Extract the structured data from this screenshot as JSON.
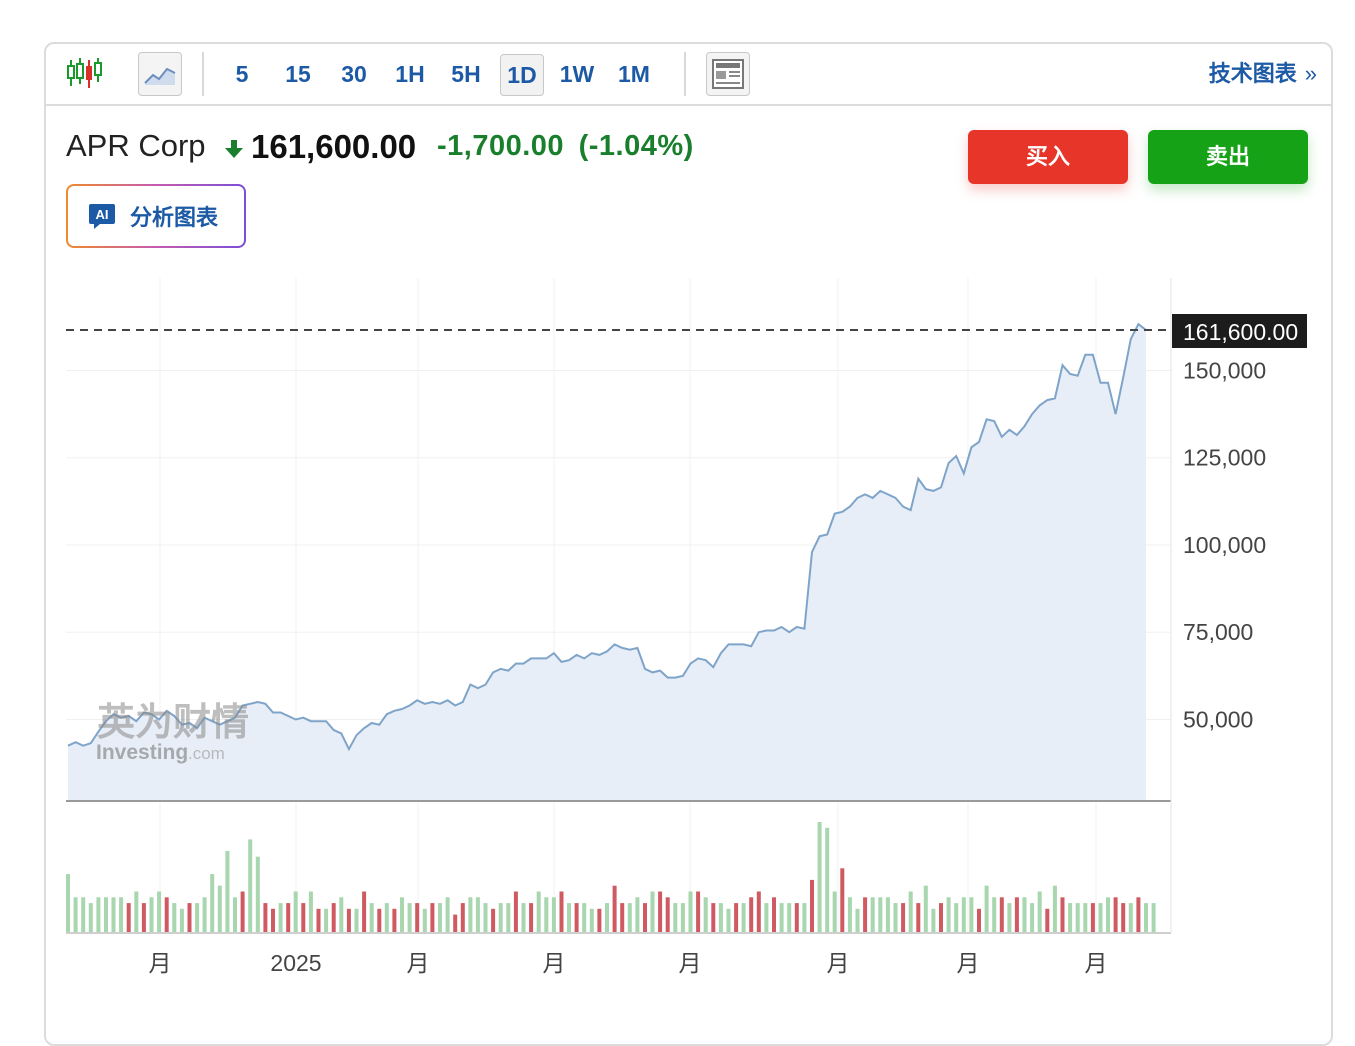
{
  "toolbar": {
    "timeframes": [
      "5",
      "15",
      "30",
      "1H",
      "5H",
      "1D",
      "1W",
      "1M"
    ],
    "active_timeframe": "1D",
    "tech_chart_label": "技术图表",
    "tech_chart_arrow": "»",
    "icons": [
      "candlestick-icon",
      "line-chart-icon",
      "layout-icon"
    ]
  },
  "quote": {
    "name": "APR Corp",
    "direction": "down",
    "price": "161,600.00",
    "change": "-1,700.00",
    "change_pct": "(-1.04%)",
    "change_color": "#1a7f2c"
  },
  "actions": {
    "buy_label": "买入",
    "sell_label": "卖出",
    "buy_color": "#e8352a",
    "sell_color": "#15a216"
  },
  "ai": {
    "badge": "AI",
    "label": "分析图表"
  },
  "watermark": {
    "cn": "英为财情",
    "en": "Investing",
    "suffix": ".com"
  },
  "chart_data": {
    "type": "area",
    "title": "",
    "xlabel": "",
    "ylabel": "",
    "x_tick_labels": [
      "月",
      "2025",
      "月",
      "月",
      "月",
      "月",
      "月",
      "月"
    ],
    "y_tick_labels": [
      "150,000",
      "125,000",
      "100,000",
      "75,000",
      "50,000"
    ],
    "y_ticks": [
      150000,
      125000,
      100000,
      75000,
      50000
    ],
    "ylim": [
      28000,
      166000
    ],
    "last_price_label": "161,600.00",
    "last_price": 161600,
    "grid": true,
    "series": [
      {
        "values": [
          42500,
          43500,
          42500,
          43200,
          46500,
          49500,
          51500,
          50500,
          51000,
          49500,
          52000,
          51500,
          50000,
          52500,
          51000,
          48500,
          49000,
          47500,
          50500,
          49500,
          48500,
          49500,
          50500,
          54000,
          54500,
          55000,
          54500,
          52000,
          52000,
          51000,
          50000,
          50500,
          49500,
          49500,
          49500,
          47000,
          46000,
          41500,
          45500,
          47500,
          49000,
          48500,
          51500,
          52500,
          53000,
          54000,
          55500,
          54500,
          55000,
          54500,
          55500,
          54000,
          55000,
          60000,
          59000,
          60000,
          63500,
          64500,
          64000,
          66000,
          66000,
          67500,
          67500,
          67500,
          69000,
          66500,
          67000,
          68500,
          67500,
          69000,
          68500,
          69500,
          71500,
          70500,
          70000,
          70500,
          64500,
          63500,
          64000,
          62000,
          62000,
          62500,
          66000,
          67500,
          67000,
          65000,
          69000,
          71500,
          71500,
          71500,
          71000,
          75000,
          75500,
          75500,
          76500,
          75000,
          76500,
          76000,
          98000,
          102500,
          103000,
          109000,
          109500,
          111000,
          113500,
          114500,
          113500,
          115500,
          114500,
          113500,
          111000,
          110000,
          119000,
          116000,
          115500,
          116500,
          123500,
          125500,
          120500,
          128000,
          129500,
          136000,
          135500,
          131000,
          133000,
          131500,
          134000,
          137500,
          140000,
          141500,
          142000,
          151500,
          149000,
          148500,
          154500,
          154500,
          146500,
          146500,
          137500,
          148000,
          159000,
          163300,
          161600
        ]
      }
    ],
    "volume": {
      "values": [
        10,
        6,
        6,
        5,
        6,
        6,
        6,
        6,
        5,
        7,
        5,
        6,
        7,
        6,
        5,
        4,
        5,
        5,
        6,
        10,
        8,
        14,
        6,
        7,
        16,
        13,
        5,
        4,
        5,
        5,
        7,
        5,
        7,
        4,
        4,
        5,
        6,
        4,
        4,
        7,
        5,
        4,
        5,
        4,
        6,
        5,
        5,
        4,
        5,
        5,
        6,
        3,
        5,
        6,
        6,
        5,
        4,
        5,
        5,
        7,
        5,
        5,
        7,
        6,
        6,
        7,
        5,
        5,
        5,
        4,
        4,
        5,
        8,
        5,
        5,
        6,
        5,
        7,
        7,
        6,
        5,
        5,
        7,
        7,
        6,
        5,
        5,
        4,
        5,
        5,
        6,
        7,
        5,
        6,
        5,
        5,
        5,
        5,
        9,
        19,
        18,
        7,
        11,
        6,
        4,
        6,
        6,
        6,
        6,
        5,
        5,
        7,
        5,
        8,
        4,
        5,
        6,
        5,
        6,
        6,
        4,
        8,
        6,
        6,
        5,
        6,
        6,
        5,
        7,
        4,
        8,
        6,
        5,
        5,
        5,
        5,
        5,
        6,
        6,
        5,
        5,
        6,
        5,
        5
      ],
      "down": [
        false,
        false,
        false,
        false,
        false,
        false,
        false,
        false,
        true,
        false,
        true,
        false,
        false,
        true,
        false,
        false,
        true,
        false,
        false,
        false,
        false,
        false,
        false,
        true,
        false,
        false,
        true,
        true,
        false,
        true,
        false,
        true,
        false,
        true,
        false,
        true,
        false,
        true,
        false,
        true,
        false,
        true,
        false,
        true,
        false,
        false,
        true,
        false,
        true,
        false,
        false,
        true,
        true,
        false,
        false,
        false,
        true,
        false,
        false,
        true,
        false,
        true,
        false,
        false,
        false,
        true,
        false,
        true,
        false,
        false,
        true,
        false,
        true,
        true,
        false,
        false,
        true,
        false,
        true,
        true,
        false,
        false,
        false,
        true,
        false,
        true,
        false,
        false,
        true,
        false,
        true,
        true,
        false,
        true,
        false,
        false,
        true,
        false,
        true,
        false,
        false,
        false,
        true,
        false,
        false,
        true,
        false,
        false,
        false,
        false,
        true,
        false,
        true,
        false,
        false,
        true,
        false,
        false,
        false,
        false,
        true,
        false,
        false,
        true,
        false,
        true,
        false,
        false,
        false,
        true,
        false,
        true,
        false,
        false,
        false,
        true,
        false,
        false,
        true,
        true,
        false,
        true,
        false,
        false
      ]
    }
  }
}
